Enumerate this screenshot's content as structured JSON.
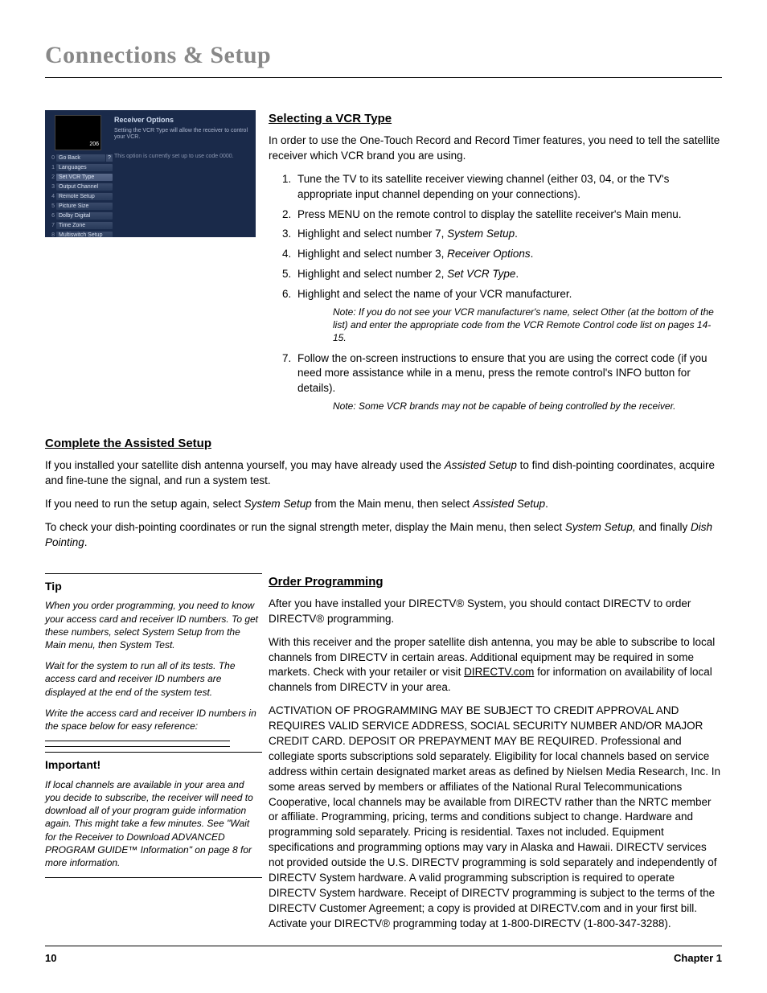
{
  "page_title": "Connections & Setup",
  "screenshot": {
    "title": "Receiver Options",
    "desc": "Setting the VCR Type will allow the receiver to control your VCR.",
    "opt": "This option is currently set up to use code 0000.",
    "menu": [
      {
        "n": "0",
        "label": "Go Back",
        "goback": true
      },
      {
        "n": "1",
        "label": "Languages"
      },
      {
        "n": "2",
        "label": "Set VCR Type",
        "sel": true
      },
      {
        "n": "3",
        "label": "Output Channel"
      },
      {
        "n": "4",
        "label": "Remote Setup"
      },
      {
        "n": "5",
        "label": "Picture Size"
      },
      {
        "n": "6",
        "label": "Dolby Digital"
      },
      {
        "n": "7",
        "label": "Time Zone"
      },
      {
        "n": "8",
        "label": "Multiswitch Setup"
      }
    ]
  },
  "vcr": {
    "heading": "Selecting a VCR Type",
    "intro": "In order to use the One-Touch Record and Record Timer features, you need to tell the satellite receiver which VCR brand you are using.",
    "s1": "Tune the TV to its satellite receiver viewing channel (either 03, 04, or the TV's appropriate input channel depending on your connections).",
    "s2": "Press MENU on the remote control to display the satellite receiver's Main menu.",
    "s3a": "Highlight and select number 7, ",
    "s3b": "System Setup",
    "s3c": ".",
    "s4a": "Highlight and select number 3, ",
    "s4b": "Receiver Options",
    "s4c": ".",
    "s5a": "Highlight and select number 2, ",
    "s5b": "Set VCR Type",
    "s5c": ".",
    "s6": "Highlight and select the name of your VCR manufacturer.",
    "note1": "Note: If you do not see your VCR manufacturer's name, select Other (at the bottom of the list) and enter the appropriate code from the VCR Remote Control code list on pages 14-15.",
    "s7": "Follow the on-screen instructions to ensure that you are using the correct code (if you need more assistance while in a menu, press the remote control's INFO button for details).",
    "note2": "Note: Some VCR brands may not be capable of being controlled by the receiver."
  },
  "assisted": {
    "heading": "Complete the Assisted Setup",
    "p1a": "If you installed your satellite dish antenna yourself, you may have already used the ",
    "p1b": "Assisted Setup",
    "p1c": " to find dish-pointing coordinates, acquire and fine-tune the signal, and run a system test.",
    "p2a": "If you need to run the setup again, select ",
    "p2b": "System Setup",
    "p2c": " from the Main menu, then select ",
    "p2d": "Assisted Setup",
    "p2e": ".",
    "p3a": "To check your dish-pointing coordinates or run the signal strength meter, display the Main menu, then select ",
    "p3b": "System Setup,",
    "p3c": " and finally ",
    "p3d": "Dish Pointing",
    "p3e": "."
  },
  "tip": {
    "title": "Tip",
    "p1": "When you order programming, you need to know your access card and receiver ID numbers. To get these numbers, select System Setup from the Main menu, then System Test.",
    "p2": "Wait for the system to run all of its tests. The access card and receiver ID numbers are displayed at the end of the system test.",
    "p3": "Write the access card and receiver ID numbers in the space below for easy reference:"
  },
  "important": {
    "title": "Important!",
    "p1": "If local channels are available in your area and you decide to subscribe, the receiver will need to download all of your program guide information again. This might take a few minutes. See \"Wait for the Receiver to Download ADVANCED PROGRAM GUIDE™ Information\" on page 8 for more information."
  },
  "order": {
    "heading": "Order Programming",
    "p1": "After you have installed your DIRECTV® System, you should contact DIRECTV to order DIRECTV® programming.",
    "p2a": "With this receiver and the proper satellite dish antenna, you may be able to subscribe to local channels from DIRECTV in certain areas. Additional equipment may be required in some markets. Check with your retailer or visit ",
    "p2b": "DIRECTV.com",
    "p2c": " for information on availability of local channels from DIRECTV in your area.",
    "p3": "ACTIVATION OF PROGRAMMING MAY BE SUBJECT TO CREDIT APPROVAL AND REQUIRES VALID SERVICE ADDRESS, SOCIAL SECURITY NUMBER AND/OR MAJOR CREDIT CARD. DEPOSIT OR PREPAYMENT MAY BE REQUIRED. Professional and collegiate sports subscriptions sold separately. Eligibility for local channels based on service address within certain designated market areas as defined by Nielsen Media Research, Inc. In some areas served by members or affiliates of the National Rural Telecommunications Cooperative, local channels may be available from DIRECTV rather than the NRTC member or affiliate. Programming, pricing, terms and conditions subject to change. Hardware and programming sold separately. Pricing is residential. Taxes not included. Equipment specifications and programming options may vary in Alaska and Hawaii. DIRECTV services not provided outside the U.S. DIRECTV programming is sold separately and independently of DIRECTV System hardware. A valid programming subscription is required to operate DIRECTV System hardware. Receipt of DIRECTV programming is subject to the terms of the DIRECTV Customer Agreement; a copy is provided at DIRECTV.com and in your first bill. Activate your DIRECTV® programming today at 1-800-DIRECTV (1-800-347-3288)."
  },
  "footer": {
    "page": "10",
    "chapter": "Chapter 1"
  }
}
